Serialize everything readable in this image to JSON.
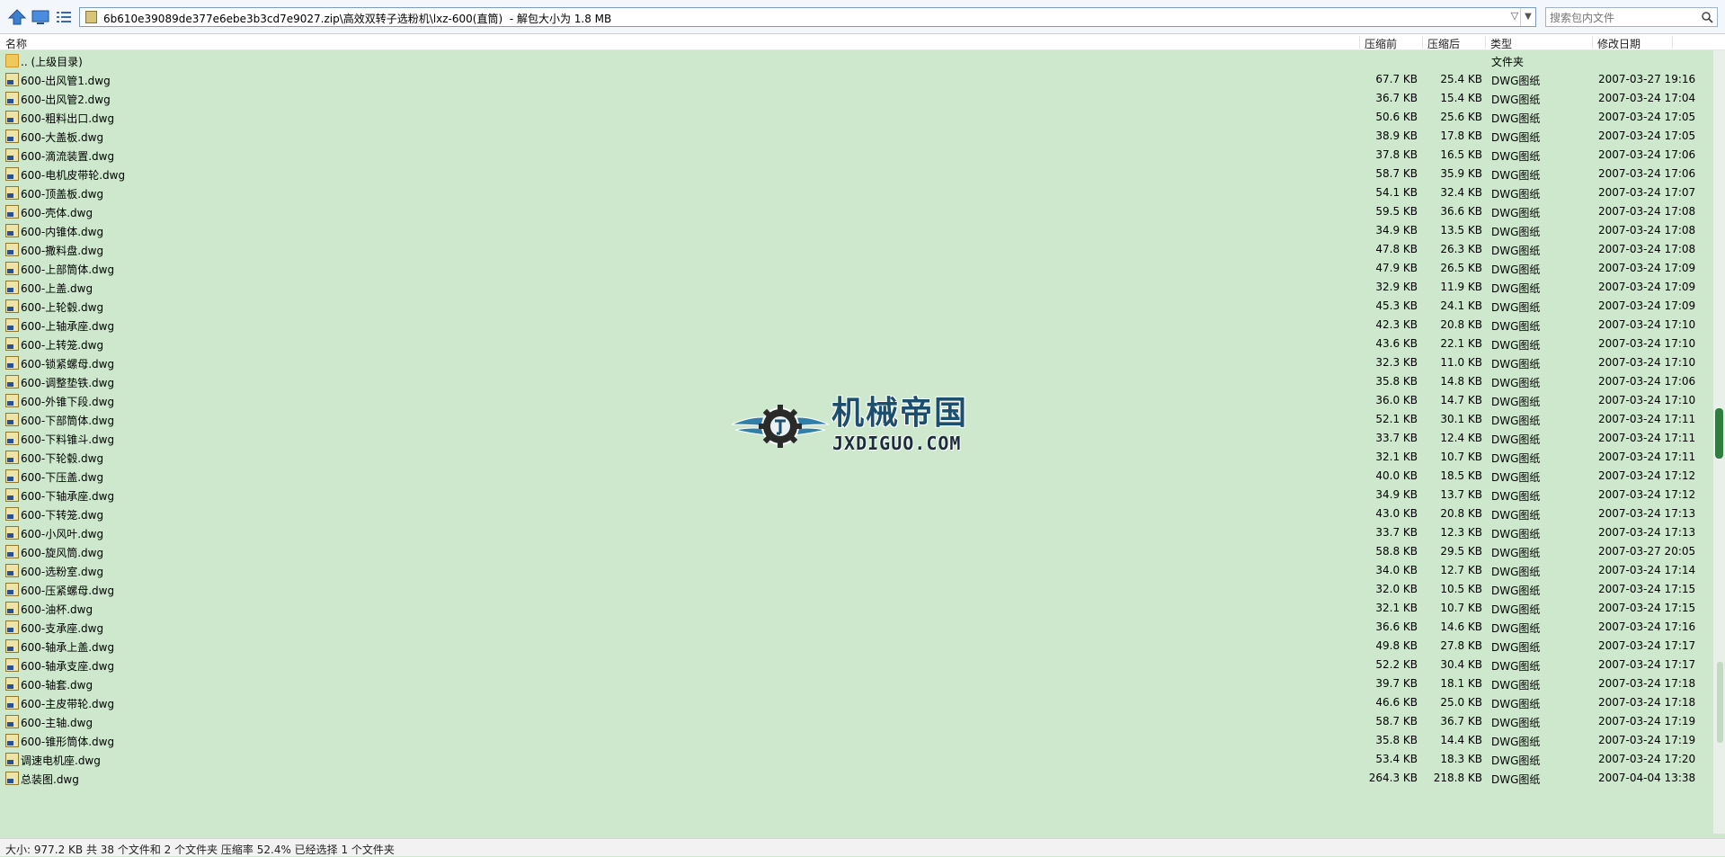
{
  "address_bar": {
    "path": "6b610e39089de377e6ebe3b3cd7e9027.zip\\高效双转子选粉机\\lxz-600(直筒)",
    "size_note": "- 解包大小为 1.8 MB"
  },
  "search": {
    "placeholder": "搜索包内文件"
  },
  "columns": {
    "name": "名称",
    "before": "压缩前",
    "after": "压缩后",
    "type": "类型",
    "date": "修改日期"
  },
  "parent_row": {
    "name": ".. (上级目录)",
    "type": "文件夹"
  },
  "files": [
    {
      "name": "600-出风管1.dwg",
      "before": "67.7 KB",
      "after": "25.4 KB",
      "type": "DWG图纸",
      "date": "2007-03-27 19:16"
    },
    {
      "name": "600-出风管2.dwg",
      "before": "36.7 KB",
      "after": "15.4 KB",
      "type": "DWG图纸",
      "date": "2007-03-24 17:04"
    },
    {
      "name": "600-粗料出口.dwg",
      "before": "50.6 KB",
      "after": "25.6 KB",
      "type": "DWG图纸",
      "date": "2007-03-24 17:05"
    },
    {
      "name": "600-大盖板.dwg",
      "before": "38.9 KB",
      "after": "17.8 KB",
      "type": "DWG图纸",
      "date": "2007-03-24 17:05"
    },
    {
      "name": "600-滴流装置.dwg",
      "before": "37.8 KB",
      "after": "16.5 KB",
      "type": "DWG图纸",
      "date": "2007-03-24 17:06"
    },
    {
      "name": "600-电机皮带轮.dwg",
      "before": "58.7 KB",
      "after": "35.9 KB",
      "type": "DWG图纸",
      "date": "2007-03-24 17:06"
    },
    {
      "name": "600-顶盖板.dwg",
      "before": "54.1 KB",
      "after": "32.4 KB",
      "type": "DWG图纸",
      "date": "2007-03-24 17:07"
    },
    {
      "name": "600-壳体.dwg",
      "before": "59.5 KB",
      "after": "36.6 KB",
      "type": "DWG图纸",
      "date": "2007-03-24 17:08"
    },
    {
      "name": "600-内锥体.dwg",
      "before": "34.9 KB",
      "after": "13.5 KB",
      "type": "DWG图纸",
      "date": "2007-03-24 17:08"
    },
    {
      "name": "600-撒料盘.dwg",
      "before": "47.8 KB",
      "after": "26.3 KB",
      "type": "DWG图纸",
      "date": "2007-03-24 17:08"
    },
    {
      "name": "600-上部筒体.dwg",
      "before": "47.9 KB",
      "after": "26.5 KB",
      "type": "DWG图纸",
      "date": "2007-03-24 17:09"
    },
    {
      "name": "600-上盖.dwg",
      "before": "32.9 KB",
      "after": "11.9 KB",
      "type": "DWG图纸",
      "date": "2007-03-24 17:09"
    },
    {
      "name": "600-上轮毂.dwg",
      "before": "45.3 KB",
      "after": "24.1 KB",
      "type": "DWG图纸",
      "date": "2007-03-24 17:09"
    },
    {
      "name": "600-上轴承座.dwg",
      "before": "42.3 KB",
      "after": "20.8 KB",
      "type": "DWG图纸",
      "date": "2007-03-24 17:10"
    },
    {
      "name": "600-上转笼.dwg",
      "before": "43.6 KB",
      "after": "22.1 KB",
      "type": "DWG图纸",
      "date": "2007-03-24 17:10"
    },
    {
      "name": "600-锁紧螺母.dwg",
      "before": "32.3 KB",
      "after": "11.0 KB",
      "type": "DWG图纸",
      "date": "2007-03-24 17:10"
    },
    {
      "name": "600-调整垫铁.dwg",
      "before": "35.8 KB",
      "after": "14.8 KB",
      "type": "DWG图纸",
      "date": "2007-03-24 17:06"
    },
    {
      "name": "600-外锥下段.dwg",
      "before": "36.0 KB",
      "after": "14.7 KB",
      "type": "DWG图纸",
      "date": "2007-03-24 17:10"
    },
    {
      "name": "600-下部筒体.dwg",
      "before": "52.1 KB",
      "after": "30.1 KB",
      "type": "DWG图纸",
      "date": "2007-03-24 17:11"
    },
    {
      "name": "600-下料锥斗.dwg",
      "before": "33.7 KB",
      "after": "12.4 KB",
      "type": "DWG图纸",
      "date": "2007-03-24 17:11"
    },
    {
      "name": "600-下轮毂.dwg",
      "before": "32.1 KB",
      "after": "10.7 KB",
      "type": "DWG图纸",
      "date": "2007-03-24 17:11"
    },
    {
      "name": "600-下压盖.dwg",
      "before": "40.0 KB",
      "after": "18.5 KB",
      "type": "DWG图纸",
      "date": "2007-03-24 17:12"
    },
    {
      "name": "600-下轴承座.dwg",
      "before": "34.9 KB",
      "after": "13.7 KB",
      "type": "DWG图纸",
      "date": "2007-03-24 17:12"
    },
    {
      "name": "600-下转笼.dwg",
      "before": "43.0 KB",
      "after": "20.8 KB",
      "type": "DWG图纸",
      "date": "2007-03-24 17:13"
    },
    {
      "name": "600-小风叶.dwg",
      "before": "33.7 KB",
      "after": "12.3 KB",
      "type": "DWG图纸",
      "date": "2007-03-24 17:13"
    },
    {
      "name": "600-旋风筒.dwg",
      "before": "58.8 KB",
      "after": "29.5 KB",
      "type": "DWG图纸",
      "date": "2007-03-27 20:05"
    },
    {
      "name": "600-选粉室.dwg",
      "before": "34.0 KB",
      "after": "12.7 KB",
      "type": "DWG图纸",
      "date": "2007-03-24 17:14"
    },
    {
      "name": "600-压紧螺母.dwg",
      "before": "32.0 KB",
      "after": "10.5 KB",
      "type": "DWG图纸",
      "date": "2007-03-24 17:15"
    },
    {
      "name": "600-油杯.dwg",
      "before": "32.1 KB",
      "after": "10.7 KB",
      "type": "DWG图纸",
      "date": "2007-03-24 17:15"
    },
    {
      "name": "600-支承座.dwg",
      "before": "36.6 KB",
      "after": "14.6 KB",
      "type": "DWG图纸",
      "date": "2007-03-24 17:16"
    },
    {
      "name": "600-轴承上盖.dwg",
      "before": "49.8 KB",
      "after": "27.8 KB",
      "type": "DWG图纸",
      "date": "2007-03-24 17:17"
    },
    {
      "name": "600-轴承支座.dwg",
      "before": "52.2 KB",
      "after": "30.4 KB",
      "type": "DWG图纸",
      "date": "2007-03-24 17:17"
    },
    {
      "name": "600-轴套.dwg",
      "before": "39.7 KB",
      "after": "18.1 KB",
      "type": "DWG图纸",
      "date": "2007-03-24 17:18"
    },
    {
      "name": "600-主皮带轮.dwg",
      "before": "46.6 KB",
      "after": "25.0 KB",
      "type": "DWG图纸",
      "date": "2007-03-24 17:18"
    },
    {
      "name": "600-主轴.dwg",
      "before": "58.7 KB",
      "after": "36.7 KB",
      "type": "DWG图纸",
      "date": "2007-03-24 17:19"
    },
    {
      "name": "600-锥形筒体.dwg",
      "before": "35.8 KB",
      "after": "14.4 KB",
      "type": "DWG图纸",
      "date": "2007-03-24 17:19"
    },
    {
      "name": "调速电机座.dwg",
      "before": "53.4 KB",
      "after": "18.3 KB",
      "type": "DWG图纸",
      "date": "2007-03-24 17:20"
    },
    {
      "name": "总装图.dwg",
      "before": "264.3 KB",
      "after": "218.8 KB",
      "type": "DWG图纸",
      "date": "2007-04-04 13:38"
    }
  ],
  "watermark": {
    "cn": "机械帝国",
    "en": "JXDIGUO.COM"
  },
  "status_bar": {
    "text": "大小: 977.2 KB 共 38 个文件和 2 个文件夹 压缩率 52.4% 已经选择 1 个文件夹"
  },
  "colors": {
    "list_background": "#cde8cd",
    "scroll_thumb": "#2f7e3f"
  },
  "icons": [
    "up-arrow-icon",
    "desktop-icon",
    "list-view-icon",
    "zip-icon",
    "search-icon",
    "folder-icon",
    "dwg-file-icon"
  ]
}
